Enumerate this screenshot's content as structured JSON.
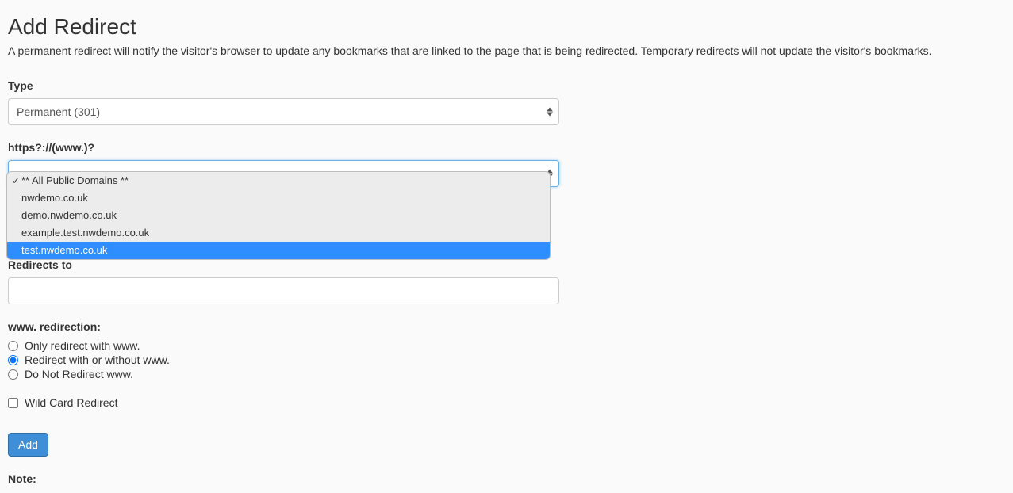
{
  "page": {
    "title": "Add Redirect",
    "description": "A permanent redirect will notify the visitor's browser to update any bookmarks that are linked to the page that is being redirected. Temporary redirects will not update the visitor's bookmarks."
  },
  "form": {
    "type_label": "Type",
    "type_value": "Permanent (301)",
    "domain_label": "https?://(www.)?",
    "domain_options": [
      {
        "label": "** All Public Domains **",
        "selected": true,
        "highlighted": false
      },
      {
        "label": "nwdemo.co.uk",
        "selected": false,
        "highlighted": false
      },
      {
        "label": "demo.nwdemo.co.uk",
        "selected": false,
        "highlighted": false
      },
      {
        "label": "example.test.nwdemo.co.uk",
        "selected": false,
        "highlighted": false
      },
      {
        "label": "test.nwdemo.co.uk",
        "selected": false,
        "highlighted": true
      }
    ],
    "redirects_to_label": "Redirects to",
    "redirects_to_value": "",
    "www_label": "www. redirection:",
    "www_options": [
      {
        "label": "Only redirect with www.",
        "checked": false
      },
      {
        "label": "Redirect with or without www.",
        "checked": true
      },
      {
        "label": "Do Not Redirect www.",
        "checked": false
      }
    ],
    "wildcard_label": "Wild Card Redirect",
    "wildcard_checked": false,
    "submit_label": "Add",
    "note_heading": "Note:"
  }
}
